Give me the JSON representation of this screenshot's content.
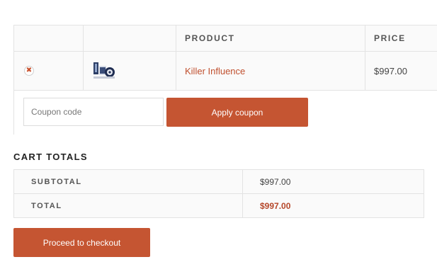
{
  "cart": {
    "headers": {
      "remove": "",
      "thumbnail": "",
      "product": "PRODUCT",
      "price": "PRICE"
    },
    "items": [
      {
        "remove_glyph": "✖",
        "thumbnail_icon": "product-thumbnail-icon",
        "name": "Killer Influence",
        "price": "$997.00"
      }
    ],
    "coupon": {
      "placeholder": "Coupon code",
      "value": "",
      "apply_label": "Apply coupon"
    }
  },
  "totals": {
    "title": "CART TOTALS",
    "rows": [
      {
        "label": "SUBTOTAL",
        "value": "$997.00"
      },
      {
        "label": "TOTAL",
        "value": "$997.00"
      }
    ]
  },
  "checkout": {
    "label": "Proceed to checkout"
  },
  "colors": {
    "accent": "#c55532",
    "link": "#c0502f",
    "total_value": "#b5472a",
    "border": "#e3e3e3"
  }
}
